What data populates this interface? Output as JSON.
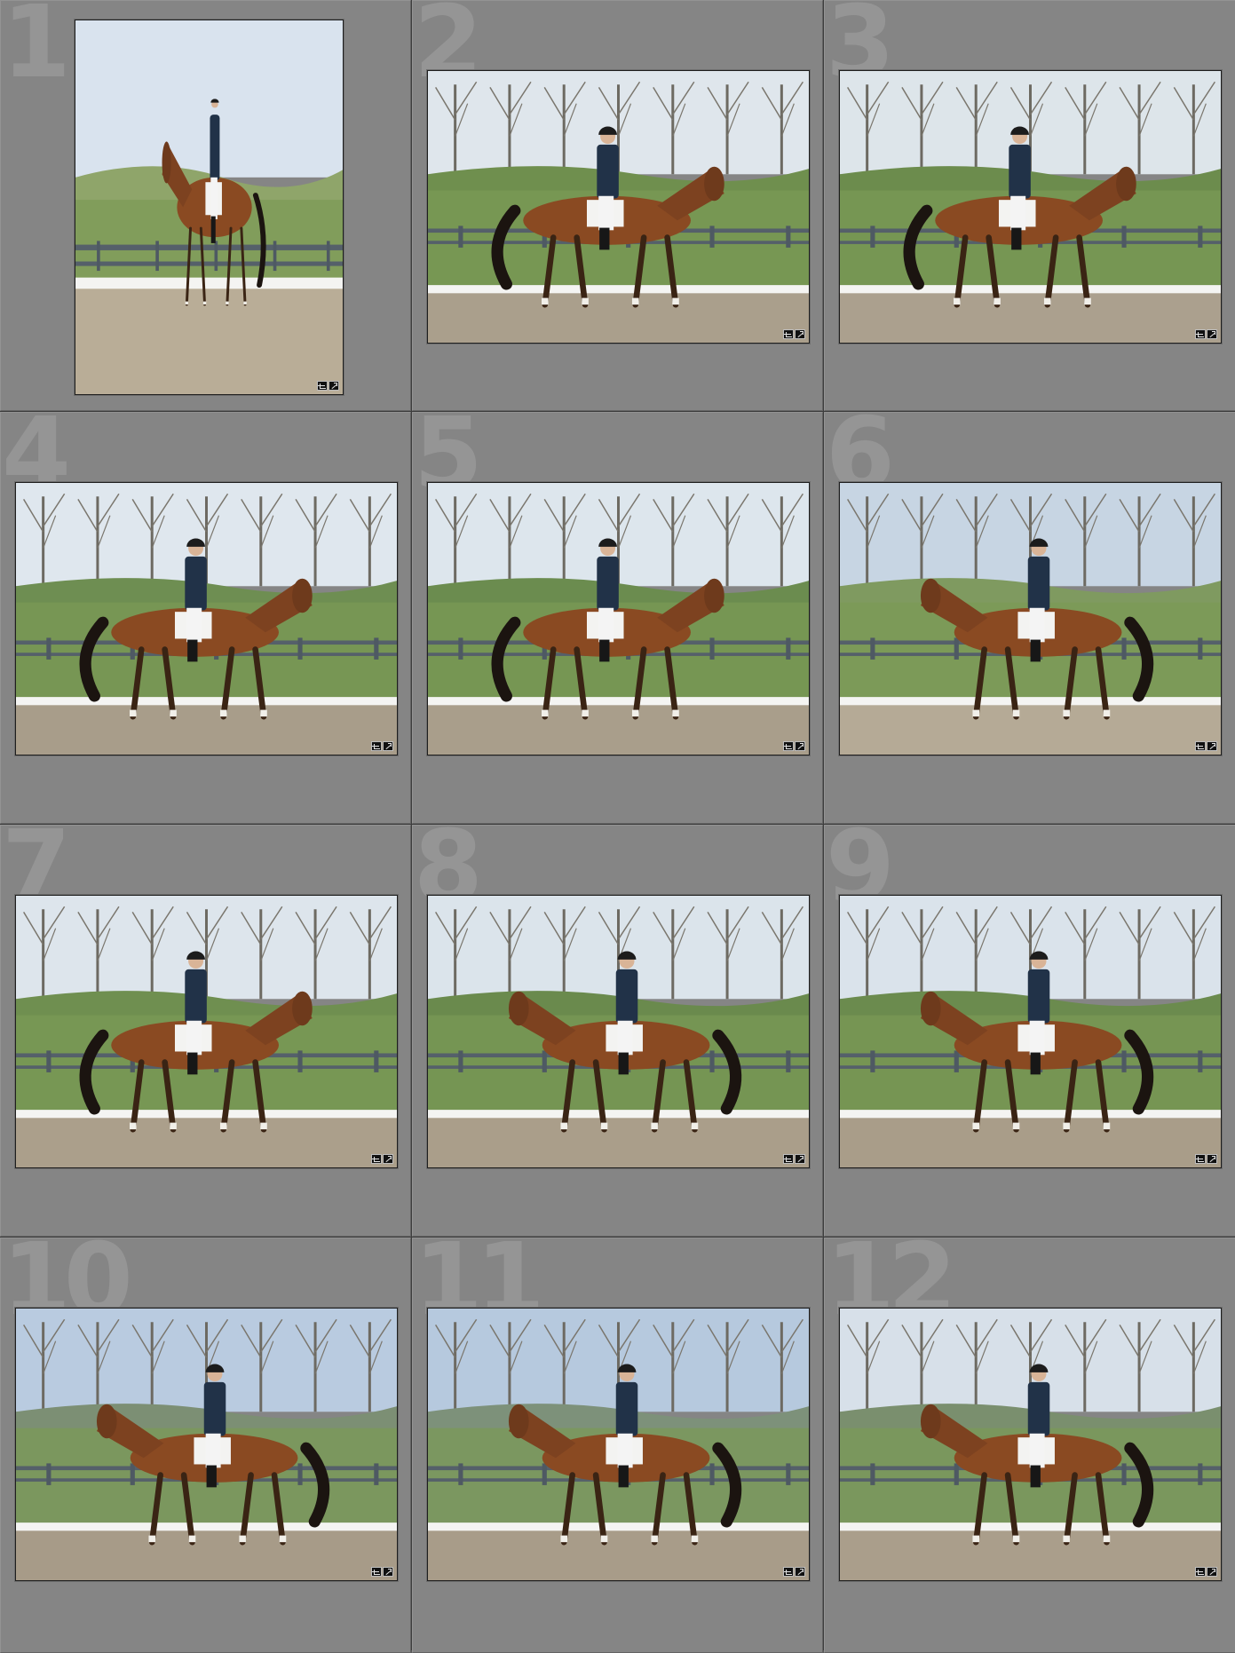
{
  "grid": {
    "cells": [
      {
        "index": "1",
        "orientation": "portrait",
        "sky": "#d9e3ee",
        "hill": "#8fa56a",
        "ground": "#b9ad97",
        "rider_side": "front",
        "badges": [
          "crop-icon",
          "develop-icon"
        ]
      },
      {
        "index": "2",
        "orientation": "landscape",
        "sky": "#dfe6ec",
        "hill": "#6f8f4e",
        "ground": "#aa9f8c",
        "rider_side": "right",
        "badges": [
          "crop-icon",
          "develop-icon"
        ]
      },
      {
        "index": "3",
        "orientation": "landscape",
        "sky": "#dde5ea",
        "hill": "#6c8c4d",
        "ground": "#aba08e",
        "rider_side": "right",
        "badges": [
          "crop-icon",
          "develop-icon"
        ]
      },
      {
        "index": "4",
        "orientation": "landscape",
        "sky": "#dfe7ee",
        "hill": "#6e8e52",
        "ground": "#a89d8a",
        "rider_side": "right",
        "badges": [
          "crop-icon",
          "develop-icon"
        ]
      },
      {
        "index": "5",
        "orientation": "landscape",
        "sky": "#dde6ed",
        "hill": "#6b8c4f",
        "ground": "#a99e8b",
        "rider_side": "right",
        "badges": [
          "crop-icon",
          "develop-icon"
        ]
      },
      {
        "index": "6",
        "orientation": "landscape",
        "sky": "#c7d5e3",
        "hill": "#7f9a60",
        "ground": "#b5aa96",
        "rider_side": "left",
        "badges": [
          "crop-icon",
          "develop-icon"
        ]
      },
      {
        "index": "7",
        "orientation": "landscape",
        "sky": "#dde5ec",
        "hill": "#6f8f50",
        "ground": "#ab9f8b",
        "rider_side": "right",
        "badges": [
          "crop-icon",
          "develop-icon"
        ]
      },
      {
        "index": "8",
        "orientation": "landscape",
        "sky": "#dbe4eb",
        "hill": "#6a8a4d",
        "ground": "#aa9e8a",
        "rider_side": "left",
        "badges": [
          "crop-icon",
          "develop-icon"
        ]
      },
      {
        "index": "9",
        "orientation": "landscape",
        "sky": "#dae3eb",
        "hill": "#6b8b4e",
        "ground": "#a99d89",
        "rider_side": "left",
        "badges": [
          "crop-icon",
          "develop-icon"
        ]
      },
      {
        "index": "10",
        "orientation": "landscape",
        "sky": "#b9cbe0",
        "hill": "#7c8f74",
        "ground": "#a79b88",
        "rider_side": "left",
        "badges": [
          "crop-icon",
          "develop-icon"
        ]
      },
      {
        "index": "11",
        "orientation": "landscape",
        "sky": "#b6c9de",
        "hill": "#7d917a",
        "ground": "#a89c89",
        "rider_side": "left",
        "badges": [
          "crop-icon",
          "develop-icon"
        ]
      },
      {
        "index": "12",
        "orientation": "landscape",
        "sky": "#d7e0e9",
        "hill": "#7a8f6e",
        "ground": "#aa9e8b",
        "rider_side": "left",
        "badges": [
          "crop-icon",
          "develop-icon"
        ]
      }
    ]
  }
}
